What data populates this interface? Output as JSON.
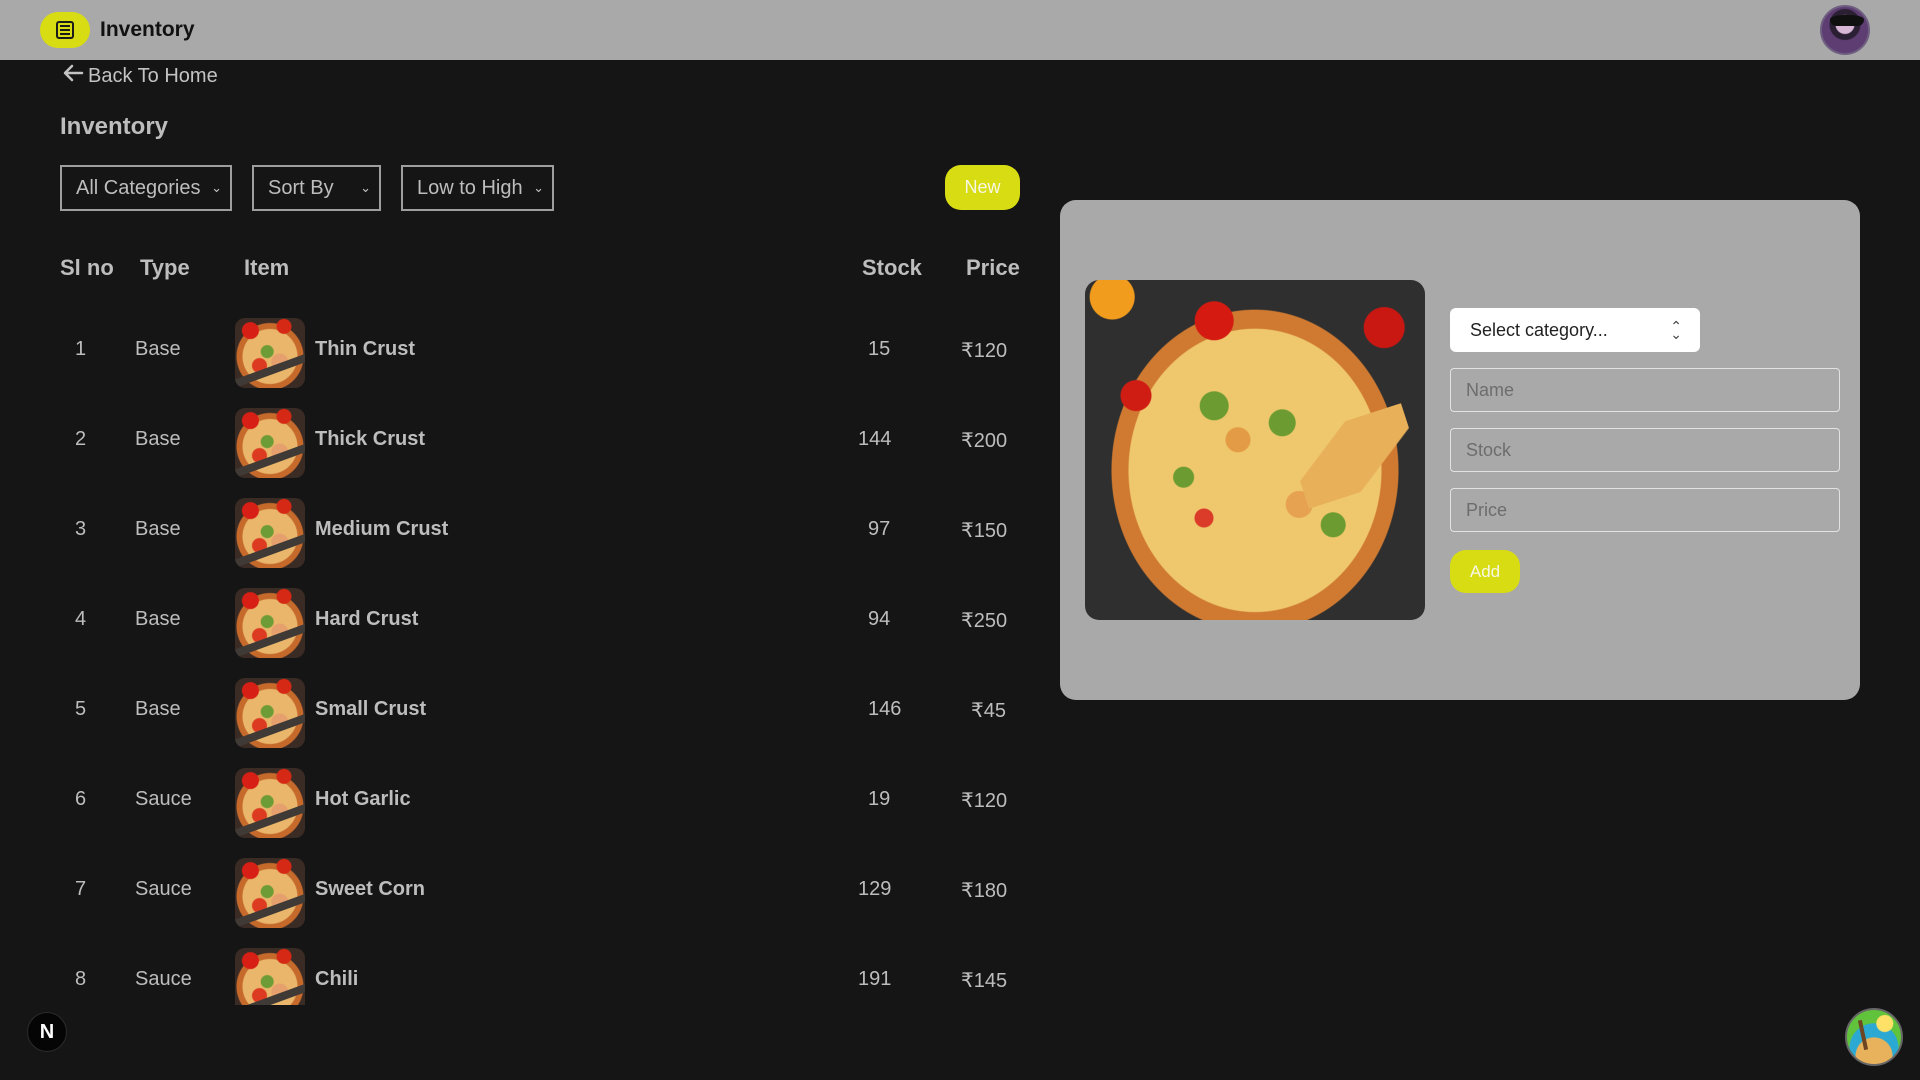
{
  "header": {
    "title": "Inventory",
    "icon": "warehouse-icon",
    "avatar": "user-avatar"
  },
  "navigation": {
    "back_label": "Back To Home",
    "back_icon": "arrow-left-icon"
  },
  "page": {
    "title": "Inventory"
  },
  "filters": {
    "category": "All Categories",
    "sort": "Sort By",
    "order": "Low to High"
  },
  "actions": {
    "new_label": "New"
  },
  "table": {
    "headers": [
      "Sl no",
      "Type",
      "Item",
      "Stock",
      "Price"
    ],
    "rows": [
      {
        "sl_no": "1",
        "type": "Base",
        "item": "Thin Crust",
        "stock": "15",
        "price": "₹120"
      },
      {
        "sl_no": "2",
        "type": "Base",
        "item": "Thick Crust",
        "stock": "144",
        "price": "₹200"
      },
      {
        "sl_no": "3",
        "type": "Base",
        "item": "Medium Crust",
        "stock": "97",
        "price": "₹150"
      },
      {
        "sl_no": "4",
        "type": "Base",
        "item": "Hard Crust",
        "stock": "94",
        "price": "₹250"
      },
      {
        "sl_no": "5",
        "type": "Base",
        "item": "Small Crust",
        "stock": "146",
        "price": "₹45"
      },
      {
        "sl_no": "6",
        "type": "Sauce",
        "item": "Hot Garlic",
        "stock": "19",
        "price": "₹120"
      },
      {
        "sl_no": "7",
        "type": "Sauce",
        "item": "Sweet Corn",
        "stock": "129",
        "price": "₹180"
      },
      {
        "sl_no": "8",
        "type": "Sauce",
        "item": "Chili",
        "stock": "191",
        "price": "₹145"
      }
    ]
  },
  "form": {
    "category_placeholder": "Select category...",
    "name_placeholder": "Name",
    "stock_placeholder": "Stock",
    "price_placeholder": "Price",
    "add_label": "Add"
  },
  "floating": {
    "next_badge": "N"
  },
  "colors": {
    "accent": "#d8dc12",
    "header": "#a9a9a9",
    "background": "#151515"
  }
}
